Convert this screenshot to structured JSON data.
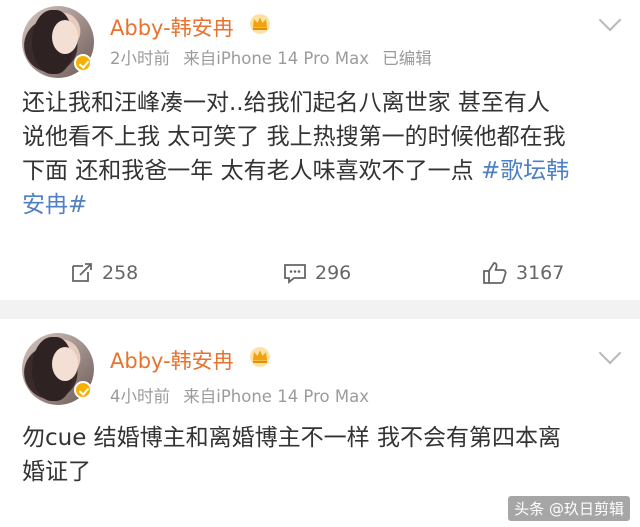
{
  "posts": [
    {
      "author": "Abby-韩安冉",
      "time": "2小时前",
      "source": "来自iPhone 14 Pro Max",
      "edited": "已编辑",
      "text_lines": [
        "还让我和汪峰凑一对..给我们起名八离世家 甚至有人",
        "说他看不上我 太可笑了 我上热搜第一的时候他都在我",
        "下面 还和我爸一年 太有老人味喜欢不了一点 "
      ],
      "hashtag_part1": "#歌坛韩",
      "hashtag_part2": "安冉#",
      "reposts": "258",
      "comments": "296",
      "likes": "3167"
    },
    {
      "author": "Abby-韩安冉",
      "time": "4小时前",
      "source": "来自iPhone 14 Pro Max",
      "text_lines": [
        "勿cue 结婚博主和离婚博主不一样 我不会有第四本离",
        "婚证了"
      ]
    }
  ],
  "watermark": "头条 @玖日剪辑",
  "colors": {
    "name": "#e8722e",
    "hashtag": "#4f7fc4",
    "meta": "#9b9b9b",
    "badge": "#f6b100"
  },
  "icons": [
    "chevron-down-icon",
    "verified-badge-icon",
    "crown-icon",
    "repost-icon",
    "comment-icon",
    "like-icon"
  ]
}
